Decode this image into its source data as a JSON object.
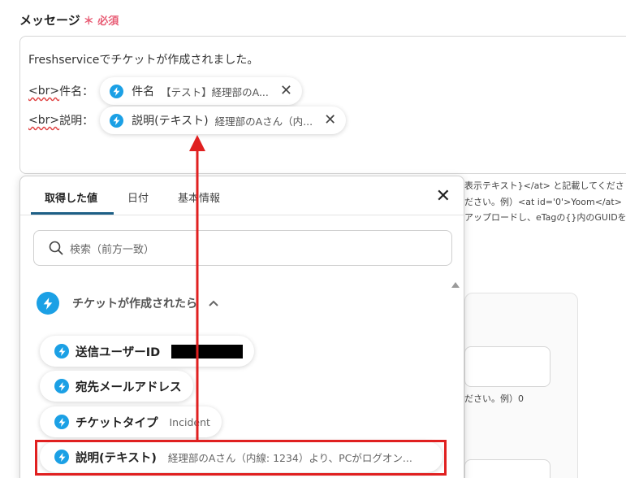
{
  "field": {
    "label": "メッセージ",
    "required_mark": "＊",
    "required_text": "必須"
  },
  "editor": {
    "line1": "Freshserviceでチケットが作成されました。",
    "row1": {
      "tag": "<br>",
      "label": "件名：",
      "chip_name": "件名",
      "chip_value": "【テスト】経理部のA..."
    },
    "row2": {
      "tag": "<br>",
      "label": "説明：",
      "chip_name": "説明(テキスト)",
      "chip_value": "経理部のAさん（内..."
    }
  },
  "background_hints": [
    "表示テキスト}</at> と記載してくださ",
    "ださい。例）<at id='0'>Yoom</at>",
    "アップロードし、eTagの{}内のGUIDを",
    "ださい。例）0"
  ],
  "popup": {
    "tabs": [
      "取得した値",
      "日付",
      "基本情報"
    ],
    "active_tab": "取得した値",
    "search_placeholder": "検索（前方一致）",
    "group_title": "チケットが作成されたら",
    "items": [
      {
        "label": "送信ユーザーID",
        "value": ""
      },
      {
        "label": "宛先メールアドレス",
        "value": ""
      },
      {
        "label": "チケットタイプ",
        "value": "Incident"
      },
      {
        "label": "説明(テキスト)",
        "value": "経理部のAさん（内線: 1234）より、PCがログオン..."
      }
    ]
  },
  "colors": {
    "accent_blue": "#1ba0e5",
    "tab_underline": "#1d5f86",
    "highlight_red": "#e02020",
    "required_pink": "#e85d75"
  }
}
